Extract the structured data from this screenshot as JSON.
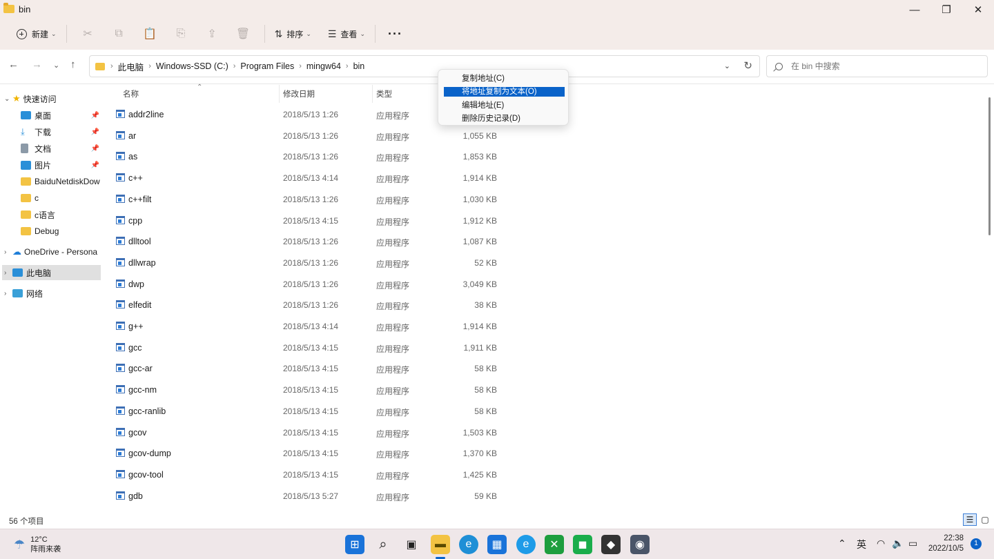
{
  "window": {
    "title": "bin",
    "minimize": "—",
    "maximize": "❐",
    "close": "✕"
  },
  "toolbar": {
    "new_label": "新建",
    "sort_label": "排序",
    "view_label": "查看",
    "more_label": "···",
    "icons": [
      "cut-icon",
      "copy-icon",
      "paste-icon",
      "rename-icon",
      "share-icon",
      "delete-icon"
    ]
  },
  "address": {
    "crumbs": [
      "此电脑",
      "Windows-SSD (C:)",
      "Program Files",
      "mingw64",
      "bin"
    ],
    "search_placeholder": "在 bin 中搜索"
  },
  "sidebar": {
    "quick_access": "快速访问",
    "items": [
      {
        "label": "桌面",
        "pinned": true,
        "color": "#2a8fd8"
      },
      {
        "label": "下载",
        "pinned": true,
        "color": "#2a8fd8"
      },
      {
        "label": "文档",
        "pinned": true,
        "color": "#8c9aa8"
      },
      {
        "label": "图片",
        "pinned": true,
        "color": "#2a8fd8"
      },
      {
        "label": "BaiduNetdiskDow",
        "pinned": false,
        "color": "#f3c343"
      },
      {
        "label": "c",
        "pinned": false,
        "color": "#f3c343"
      },
      {
        "label": "c语言",
        "pinned": false,
        "color": "#f3c343"
      },
      {
        "label": "Debug",
        "pinned": false,
        "color": "#f3c343"
      }
    ],
    "onedrive": "OneDrive - Persona",
    "this_pc": "此电脑",
    "network": "网络"
  },
  "columns": {
    "name": "名称",
    "date": "修改日期",
    "type": "类型"
  },
  "files": [
    {
      "name": "addr2line",
      "date": "2018/5/13 1:26",
      "type": "应用程序",
      "size": ""
    },
    {
      "name": "ar",
      "date": "2018/5/13 1:26",
      "type": "应用程序",
      "size": "1,055 KB"
    },
    {
      "name": "as",
      "date": "2018/5/13 1:26",
      "type": "应用程序",
      "size": "1,853 KB"
    },
    {
      "name": "c++",
      "date": "2018/5/13 4:14",
      "type": "应用程序",
      "size": "1,914 KB"
    },
    {
      "name": "c++filt",
      "date": "2018/5/13 1:26",
      "type": "应用程序",
      "size": "1,030 KB"
    },
    {
      "name": "cpp",
      "date": "2018/5/13 4:15",
      "type": "应用程序",
      "size": "1,912 KB"
    },
    {
      "name": "dlltool",
      "date": "2018/5/13 1:26",
      "type": "应用程序",
      "size": "1,087 KB"
    },
    {
      "name": "dllwrap",
      "date": "2018/5/13 1:26",
      "type": "应用程序",
      "size": "52 KB"
    },
    {
      "name": "dwp",
      "date": "2018/5/13 1:26",
      "type": "应用程序",
      "size": "3,049 KB"
    },
    {
      "name": "elfedit",
      "date": "2018/5/13 1:26",
      "type": "应用程序",
      "size": "38 KB"
    },
    {
      "name": "g++",
      "date": "2018/5/13 4:14",
      "type": "应用程序",
      "size": "1,914 KB"
    },
    {
      "name": "gcc",
      "date": "2018/5/13 4:15",
      "type": "应用程序",
      "size": "1,911 KB"
    },
    {
      "name": "gcc-ar",
      "date": "2018/5/13 4:15",
      "type": "应用程序",
      "size": "58 KB"
    },
    {
      "name": "gcc-nm",
      "date": "2018/5/13 4:15",
      "type": "应用程序",
      "size": "58 KB"
    },
    {
      "name": "gcc-ranlib",
      "date": "2018/5/13 4:15",
      "type": "应用程序",
      "size": "58 KB"
    },
    {
      "name": "gcov",
      "date": "2018/5/13 4:15",
      "type": "应用程序",
      "size": "1,503 KB"
    },
    {
      "name": "gcov-dump",
      "date": "2018/5/13 4:15",
      "type": "应用程序",
      "size": "1,370 KB"
    },
    {
      "name": "gcov-tool",
      "date": "2018/5/13 4:15",
      "type": "应用程序",
      "size": "1,425 KB"
    },
    {
      "name": "gdb",
      "date": "2018/5/13 5:27",
      "type": "应用程序",
      "size": "59 KB"
    }
  ],
  "context_menu": {
    "items": [
      "复制地址(C)",
      "将地址复制为文本(O)",
      "编辑地址(E)",
      "删除历史记录(D)"
    ],
    "highlighted_index": 1
  },
  "status": {
    "count": "56 个项目"
  },
  "taskbar": {
    "weather_temp": "12°C",
    "weather_desc": "阵雨来袭",
    "ime": "英",
    "time": "22:38",
    "date": "2022/10/5",
    "notifications": "1",
    "accent": "#0a63c9"
  }
}
